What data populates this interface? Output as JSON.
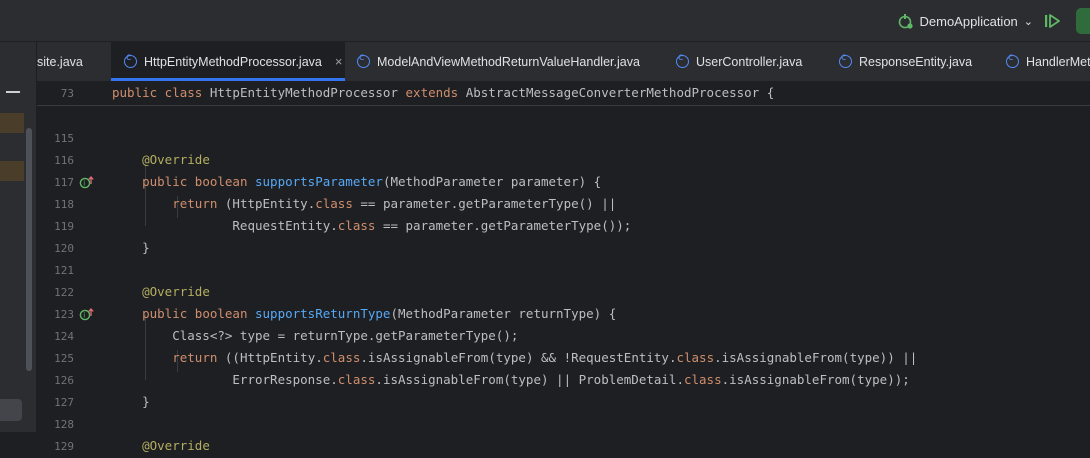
{
  "toolbar": {
    "run_config": "DemoApplication",
    "colors": {
      "bg": "#2b2d30",
      "accent": "#3574f0",
      "run_green": "#5fb865"
    }
  },
  "tabs": [
    {
      "label": "site.java",
      "active": false,
      "icon": ""
    },
    {
      "label": "HttpEntityMethodProcessor.java",
      "active": true,
      "icon": "class-icon",
      "close": "×"
    },
    {
      "label": "ModelAndViewMethodReturnValueHandler.java",
      "active": false,
      "icon": "class-icon"
    },
    {
      "label": "UserController.java",
      "active": false,
      "icon": "class-icon"
    },
    {
      "label": "ResponseEntity.java",
      "active": false,
      "icon": "class-icon"
    },
    {
      "label": "HandlerMet",
      "active": false,
      "icon": "class-icon"
    }
  ],
  "editor": {
    "sticky": {
      "number": "73",
      "tokens": [
        {
          "t": "public class ",
          "c": "kw"
        },
        {
          "t": "HttpEntityMethodProcessor ",
          "c": "tx"
        },
        {
          "t": "extends ",
          "c": "kw"
        },
        {
          "t": "AbstractMessageConverterMethodProcessor {",
          "c": "tx"
        }
      ]
    },
    "lines": [
      {
        "number": "115",
        "tokens": []
      },
      {
        "number": "116",
        "tokens": [
          {
            "t": "    ",
            "c": "tx"
          },
          {
            "t": "@Override",
            "c": "ann"
          }
        ]
      },
      {
        "number": "117",
        "gutter": "implements-icon",
        "tokens": [
          {
            "t": "    ",
            "c": "tx"
          },
          {
            "t": "public boolean ",
            "c": "kw"
          },
          {
            "t": "supportsParameter",
            "c": "fn"
          },
          {
            "t": "(MethodParameter parameter) {",
            "c": "tx"
          }
        ]
      },
      {
        "number": "118",
        "tokens": [
          {
            "t": "        ",
            "c": "tx"
          },
          {
            "t": "return ",
            "c": "kw"
          },
          {
            "t": "(HttpEntity.",
            "c": "tx"
          },
          {
            "t": "class",
            "c": "kw"
          },
          {
            "t": " == parameter.getParameterType() ||",
            "c": "tx"
          }
        ]
      },
      {
        "number": "119",
        "tokens": [
          {
            "t": "                RequestEntity.",
            "c": "tx"
          },
          {
            "t": "class",
            "c": "kw"
          },
          {
            "t": " == parameter.getParameterType());",
            "c": "tx"
          }
        ]
      },
      {
        "number": "120",
        "tokens": [
          {
            "t": "    }",
            "c": "tx"
          }
        ]
      },
      {
        "number": "121",
        "tokens": []
      },
      {
        "number": "122",
        "tokens": [
          {
            "t": "    ",
            "c": "tx"
          },
          {
            "t": "@Override",
            "c": "ann"
          }
        ]
      },
      {
        "number": "123",
        "gutter": "implements-icon",
        "tokens": [
          {
            "t": "    ",
            "c": "tx"
          },
          {
            "t": "public boolean ",
            "c": "kw"
          },
          {
            "t": "supportsReturnType",
            "c": "fn"
          },
          {
            "t": "(MethodParameter returnType) {",
            "c": "tx"
          }
        ]
      },
      {
        "number": "124",
        "tokens": [
          {
            "t": "        Class<?> type = returnType.getParameterType();",
            "c": "tx"
          }
        ]
      },
      {
        "number": "125",
        "tokens": [
          {
            "t": "        ",
            "c": "tx"
          },
          {
            "t": "return ",
            "c": "kw"
          },
          {
            "t": "((HttpEntity.",
            "c": "tx"
          },
          {
            "t": "class",
            "c": "kw"
          },
          {
            "t": ".isAssignableFrom(type) && !RequestEntity.",
            "c": "tx"
          },
          {
            "t": "class",
            "c": "kw"
          },
          {
            "t": ".isAssignableFrom(type)) ||",
            "c": "tx"
          }
        ]
      },
      {
        "number": "126",
        "tokens": [
          {
            "t": "                ErrorResponse.",
            "c": "tx"
          },
          {
            "t": "class",
            "c": "kw"
          },
          {
            "t": ".isAssignableFrom(type) || ProblemDetail.",
            "c": "tx"
          },
          {
            "t": "class",
            "c": "kw"
          },
          {
            "t": ".isAssignableFrom(type));",
            "c": "tx"
          }
        ]
      },
      {
        "number": "127",
        "tokens": [
          {
            "t": "    }",
            "c": "tx"
          }
        ]
      },
      {
        "number": "128",
        "tokens": []
      },
      {
        "number": "129",
        "tokens": [
          {
            "t": "    ",
            "c": "tx"
          },
          {
            "t": "@Override",
            "c": "ann"
          }
        ]
      }
    ]
  }
}
